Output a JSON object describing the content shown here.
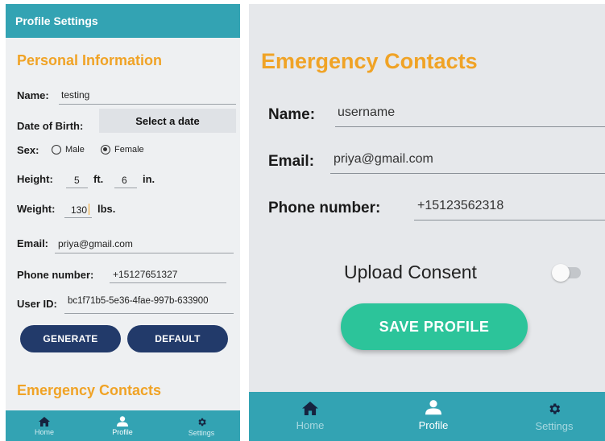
{
  "left": {
    "header": {
      "title": "Profile Settings"
    },
    "personal": {
      "section_title": "Personal Information",
      "name_label": "Name:",
      "name_value": "testing",
      "dob_label": "Date of Birth:",
      "dob_button": "Select a date",
      "sex_label": "Sex:",
      "sex_options": [
        "Male",
        "Female"
      ],
      "sex_selected": "Female",
      "height_label": "Height:",
      "height_ft": "5",
      "ft_unit": "ft.",
      "height_in": "6",
      "in_unit": "in.",
      "weight_label": "Weight:",
      "weight_value": "130",
      "weight_unit": "lbs.",
      "email_label": "Email:",
      "email_value": "priya@gmail.com",
      "phone_label": "Phone number:",
      "phone_value": "+15127651327",
      "userid_label": "User ID:",
      "userid_value": "bc1f71b5-5e36-4fae-997b-633900"
    },
    "buttons": {
      "generate": "GENERATE",
      "default": "DEFAULT"
    },
    "emergency_title": "Emergency Contacts",
    "nav": [
      {
        "label": "Home",
        "icon": "home-icon"
      },
      {
        "label": "Profile",
        "icon": "person-icon"
      },
      {
        "label": "Settings",
        "icon": "gear-icon"
      }
    ],
    "nav_active": "Profile"
  },
  "right": {
    "title": "Emergency Contacts",
    "name_label": "Name:",
    "name_value": "username",
    "email_label": "Email:",
    "email_value": "priya@gmail.com",
    "phone_label": "Phone number:",
    "phone_value": "+15123562318",
    "consent_label": "Upload Consent",
    "consent_on": false,
    "save_button": "SAVE PROFILE",
    "nav": [
      {
        "label": "Home",
        "icon": "home-icon"
      },
      {
        "label": "Profile",
        "icon": "person-icon"
      },
      {
        "label": "Settings",
        "icon": "gear-icon"
      }
    ],
    "nav_active": "Profile"
  },
  "colors": {
    "header_teal": "#33a3b3",
    "accent_orange": "#f0a326",
    "button_navy": "#223a6a",
    "save_green": "#2cc49a",
    "panel_bg": "#eef0f2"
  }
}
